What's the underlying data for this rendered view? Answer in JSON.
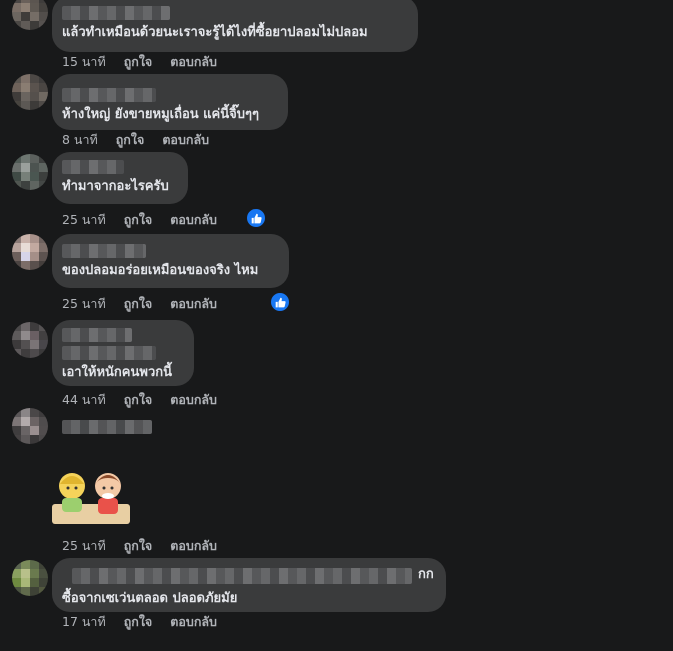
{
  "comments": [
    {
      "text": "แล้วทำเหมือนด้วยนะเราจะรู้ได้ไงที่ซื้อยาปลอมไม่ปลอม",
      "time": "15 นาที",
      "like": "ถูกใจ",
      "reply": "ตอบกลับ"
    },
    {
      "text": "ห้างใหญ่ ยังขายหมูเถื่อน แค่นี้จิ๊บๆๆ",
      "time": "8 นาที",
      "like": "ถูกใจ",
      "reply": "ตอบกลับ"
    },
    {
      "text": "ทำมาจากอะไรครับ",
      "time": "25 นาที",
      "like": "ถูกใจ",
      "reply": "ตอบกลับ"
    },
    {
      "text": "ของปลอมอร่อยเหมือนของจริง ไหม",
      "time": "25 นาที",
      "like": "ถูกใจ",
      "reply": "ตอบกลับ"
    },
    {
      "text": "เอาให้หนักคนพวกนี้",
      "time": "44 นาที",
      "like": "ถูกใจ",
      "reply": "ตอบกลับ"
    },
    {
      "time": "25 นาที",
      "like": "ถูกใจ",
      "reply": "ตอบกลับ"
    },
    {
      "text_line1_end": "กก",
      "text_line2": "ซื้อจากเซเว่นตลอด ปลอดภัยมัย",
      "time": "17 นาที",
      "like": "ถูกใจ",
      "reply": "ตอบกลับ"
    }
  ],
  "colors": {
    "background": "#18191a",
    "bubble": "#3a3b3c",
    "text": "#e4e6eb",
    "meta": "#b0b3b8",
    "like_badge": "#1877f2"
  },
  "icons": {
    "reaction": "thumbs-up-icon",
    "sticker": "cartoon-kids-sticker"
  }
}
